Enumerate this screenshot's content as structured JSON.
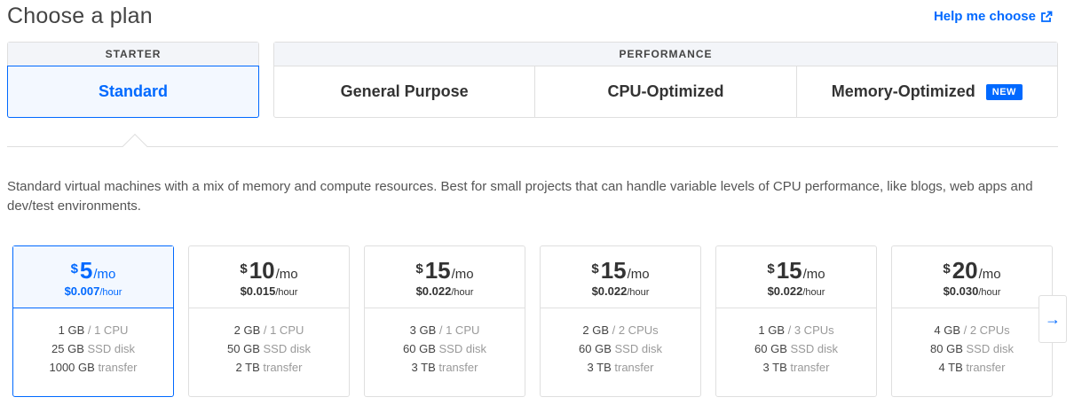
{
  "header": {
    "title": "Choose a plan",
    "help_label": "Help me choose"
  },
  "groups": {
    "starter": {
      "label": "STARTER",
      "tabs": [
        {
          "label": "Standard"
        }
      ]
    },
    "performance": {
      "label": "PERFORMANCE",
      "tabs": [
        {
          "label": "General Purpose"
        },
        {
          "label": "CPU-Optimized"
        },
        {
          "label": "Memory-Optimized",
          "badge": "NEW"
        }
      ]
    }
  },
  "description": "Standard virtual machines with a mix of memory and compute resources. Best for small projects that can handle variable levels of CPU performance, like blogs, web apps and dev/test environments.",
  "plans": [
    {
      "currency": "$",
      "price": "5",
      "per": "/mo",
      "hourly": "$0.007",
      "hourly_unit": "/hour",
      "memory": "1 GB",
      "cpu": "/ 1 CPU",
      "disk": "25 GB",
      "disk_label": "SSD disk",
      "transfer": "1000 GB",
      "transfer_label": "transfer",
      "selected": true
    },
    {
      "currency": "$",
      "price": "10",
      "per": "/mo",
      "hourly": "$0.015",
      "hourly_unit": "/hour",
      "memory": "2 GB",
      "cpu": "/ 1 CPU",
      "disk": "50 GB",
      "disk_label": "SSD disk",
      "transfer": "2 TB",
      "transfer_label": "transfer"
    },
    {
      "currency": "$",
      "price": "15",
      "per": "/mo",
      "hourly": "$0.022",
      "hourly_unit": "/hour",
      "memory": "3 GB",
      "cpu": "/ 1 CPU",
      "disk": "60 GB",
      "disk_label": "SSD disk",
      "transfer": "3 TB",
      "transfer_label": "transfer"
    },
    {
      "currency": "$",
      "price": "15",
      "per": "/mo",
      "hourly": "$0.022",
      "hourly_unit": "/hour",
      "memory": "2 GB",
      "cpu": "/ 2 CPUs",
      "disk": "60 GB",
      "disk_label": "SSD disk",
      "transfer": "3 TB",
      "transfer_label": "transfer"
    },
    {
      "currency": "$",
      "price": "15",
      "per": "/mo",
      "hourly": "$0.022",
      "hourly_unit": "/hour",
      "memory": "1 GB",
      "cpu": "/ 3 CPUs",
      "disk": "60 GB",
      "disk_label": "SSD disk",
      "transfer": "3 TB",
      "transfer_label": "transfer"
    },
    {
      "currency": "$",
      "price": "20",
      "per": "/mo",
      "hourly": "$0.030",
      "hourly_unit": "/hour",
      "memory": "4 GB",
      "cpu": "/ 2 CPUs",
      "disk": "80 GB",
      "disk_label": "SSD disk",
      "transfer": "4 TB",
      "transfer_label": "transfer"
    }
  ],
  "next_icon": "arrow-right-icon",
  "colors": {
    "accent": "#0069ff",
    "selected_bg": "#f3f8ff",
    "border": "#dfdfdf"
  }
}
